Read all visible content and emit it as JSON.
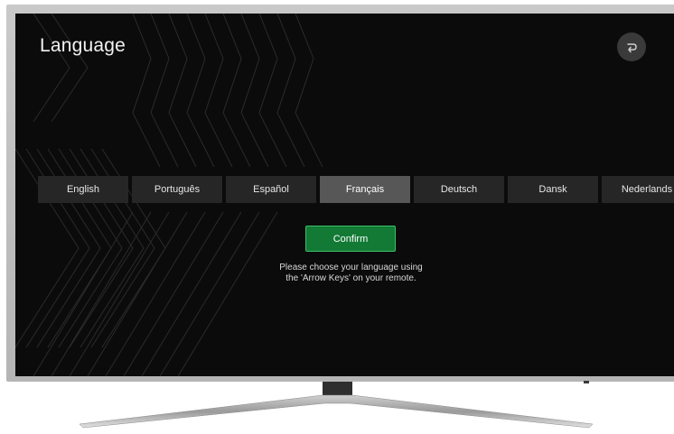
{
  "screen": {
    "title": "Language",
    "back_icon": "return-arrow-icon"
  },
  "languages": [
    {
      "label": "English",
      "selected": false
    },
    {
      "label": "Português",
      "selected": false
    },
    {
      "label": "Español",
      "selected": false
    },
    {
      "label": "Français",
      "selected": true
    },
    {
      "label": "Deutsch",
      "selected": false
    },
    {
      "label": "Dansk",
      "selected": false
    },
    {
      "label": "Nederlands",
      "selected": false
    }
  ],
  "confirm": {
    "label": "Confirm"
  },
  "hint": {
    "line1": "Please choose your language using",
    "line2": "the 'Arrow Keys' on your remote."
  },
  "colors": {
    "screen_background": "#0b0b0b",
    "tile_background": "#262626",
    "tile_selected": "#575757",
    "confirm_green": "#127a35",
    "confirm_border": "#3fbf67",
    "bezel": "#c0c0c0"
  }
}
